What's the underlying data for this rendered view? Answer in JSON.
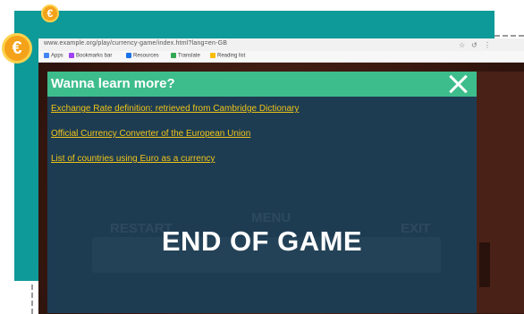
{
  "browser": {
    "url": "www.example.org/play/currency-game/index.html?lang=en-GB",
    "controls": [
      "☆",
      "↺",
      "⋮"
    ],
    "bookmarks": [
      {
        "label": "Apps",
        "color": "#4285f4"
      },
      {
        "label": "Bookmarks bar",
        "color": "#a142f4"
      },
      {
        "label": "Resources",
        "color": "#1a73e8"
      },
      {
        "label": "Translate",
        "color": "#34a853"
      },
      {
        "label": "Reading list",
        "color": "#fbbc05"
      }
    ]
  },
  "modal": {
    "title": "Wanna learn more?",
    "links": [
      "Exchange Rate definition: retrieved from Cambridge Dictionary",
      "Official Currency Converter of the European Union",
      "List of countries using Euro as a currency"
    ]
  },
  "background_buttons": {
    "left": "RESTART",
    "middle": "MENU",
    "right": "EXIT"
  },
  "end_text": "END OF GAME",
  "coin_symbol": "€",
  "colors": {
    "teal": "#0e9a98",
    "header_green": "#3ebd8c",
    "modal_bg": "#1d3c52",
    "link_yellow": "#f0c419",
    "coin_orange": "#f4a21a"
  }
}
